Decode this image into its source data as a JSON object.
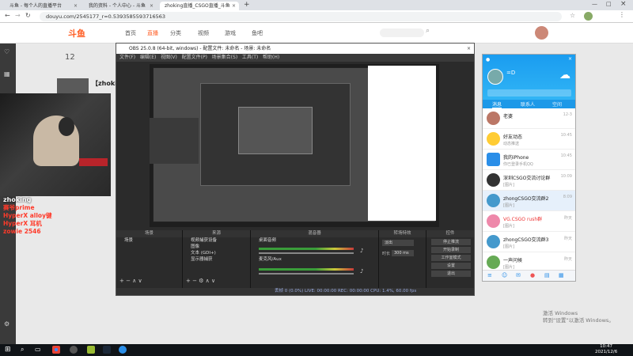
{
  "browser": {
    "tabs": [
      {
        "label": "斗鱼 - 每个人的直播平台"
      },
      {
        "label": "我的资料 - 个人中心 - 斗鱼"
      },
      {
        "label": "zhoking直播_CSGO直播_斗鱼"
      }
    ],
    "url": "douyu.com/2545177_r=0.5393585593716563"
  },
  "site": {
    "nav": [
      "首页",
      "直播",
      "分类",
      "视频",
      "游戏",
      "鱼吧"
    ],
    "left_rail_count": "12",
    "streamer_name": "【zhoking",
    "chat": {
      "username": "zhoking",
      "lines": [
        "赛爷prime",
        "HyperX alloy键",
        "HyperX 耳机",
        "zowie 2546"
      ]
    }
  },
  "obs": {
    "title": "OBS 25.0.8 (64-bit, windows) - 配置文件: 未命名 - 场景: 未命名",
    "menu": [
      "文件(F)",
      "编辑(E)",
      "视图(V)",
      "配置文件(P)",
      "场景集合(S)",
      "工具(T)",
      "帮助(H)"
    ],
    "docks": {
      "scenes_header": "场景",
      "scene_item": "场景",
      "sources_header": "来源",
      "sources": [
        "视频捕获设备",
        "图像",
        "文本 (GDI+)",
        "显示器捕获"
      ],
      "mixer_header": "混音器",
      "mixer_channels": [
        "桌面音频",
        "麦克风/Aux"
      ],
      "transitions_header": "转场特效",
      "transition_value": "淡出",
      "duration_label": "时长",
      "duration_value": "300 ms",
      "controls_header": "控件",
      "controls": [
        "停止推流",
        "开始录制",
        "工作室模式",
        "设置",
        "退出"
      ]
    },
    "status": "丢帧 0 (0.0%)  LIVE: 00:00:00  REC: 00:00:00  CPU: 1.4%, 60.00 fps"
  },
  "qq": {
    "username": "=D",
    "tabs": [
      "消息",
      "联系人",
      "空间"
    ],
    "items": [
      {
        "name": "老婆",
        "time": "12-3",
        "msg": ""
      },
      {
        "name": "好友动态",
        "time": "10:45",
        "msg": "动态推送"
      },
      {
        "name": "我的iPhone",
        "time": "10:45",
        "msg": "你已登录手机QQ"
      },
      {
        "name": "深圳CSGO交流讨论群",
        "time": "10:09",
        "msg": "[图片]"
      },
      {
        "name": "zhongCSGO交流群2",
        "time": "8:09",
        "msg": "[图片]"
      },
      {
        "name": "VG.CSGO rush群",
        "time": "昨天",
        "msg": "[图片]"
      },
      {
        "name": "zhongCSGO交流群3",
        "time": "昨天",
        "msg": "[图片]"
      },
      {
        "name": "一声问候",
        "time": "昨天",
        "msg": "[图片]"
      }
    ]
  },
  "taskbar": {
    "time": "10:47",
    "date": "2021/12/6"
  },
  "watermark": {
    "line1": "激活 Windows",
    "line2": "转到“设置”以激活 Windows。"
  },
  "colors": {
    "accent": "#ff5d23",
    "qq_blue": "#1a9cf0",
    "chat_red": "#ff3a2a"
  }
}
